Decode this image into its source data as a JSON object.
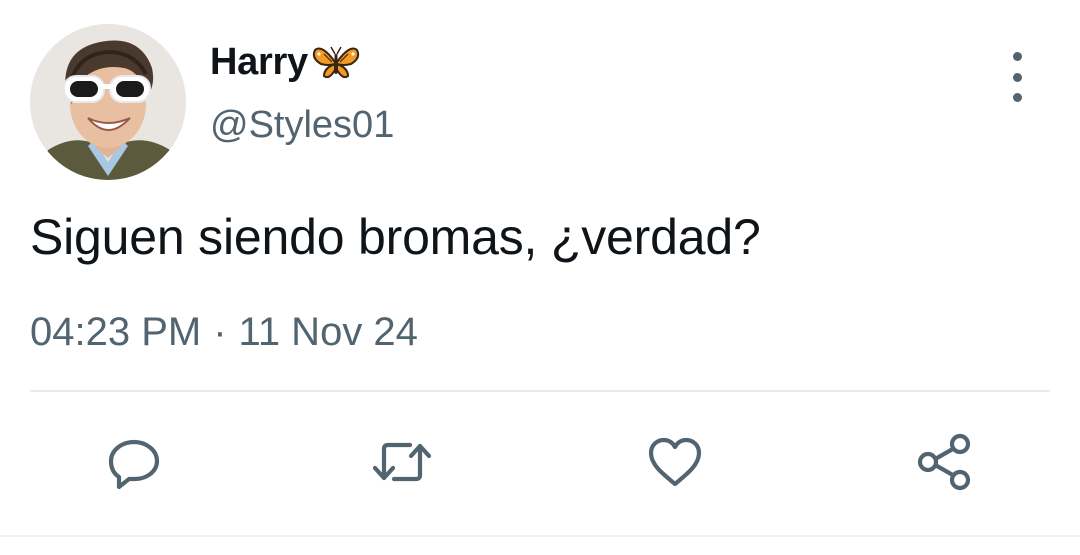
{
  "tweet": {
    "display_name": "Harry",
    "name_emoji": "butterfly-emoji",
    "handle": "@Styles01",
    "text": "Siguen siendo bromas, ¿verdad?",
    "time": "04:23 PM",
    "separator": "·",
    "date": "11 Nov 24"
  },
  "actions": [
    {
      "name": "reply",
      "icon": "reply-icon"
    },
    {
      "name": "retweet",
      "icon": "retweet-icon"
    },
    {
      "name": "like",
      "icon": "heart-icon"
    },
    {
      "name": "share",
      "icon": "share-icon"
    }
  ],
  "colors": {
    "text_primary": "#0f1419",
    "text_secondary": "#536471",
    "divider": "#e6ecf0"
  }
}
